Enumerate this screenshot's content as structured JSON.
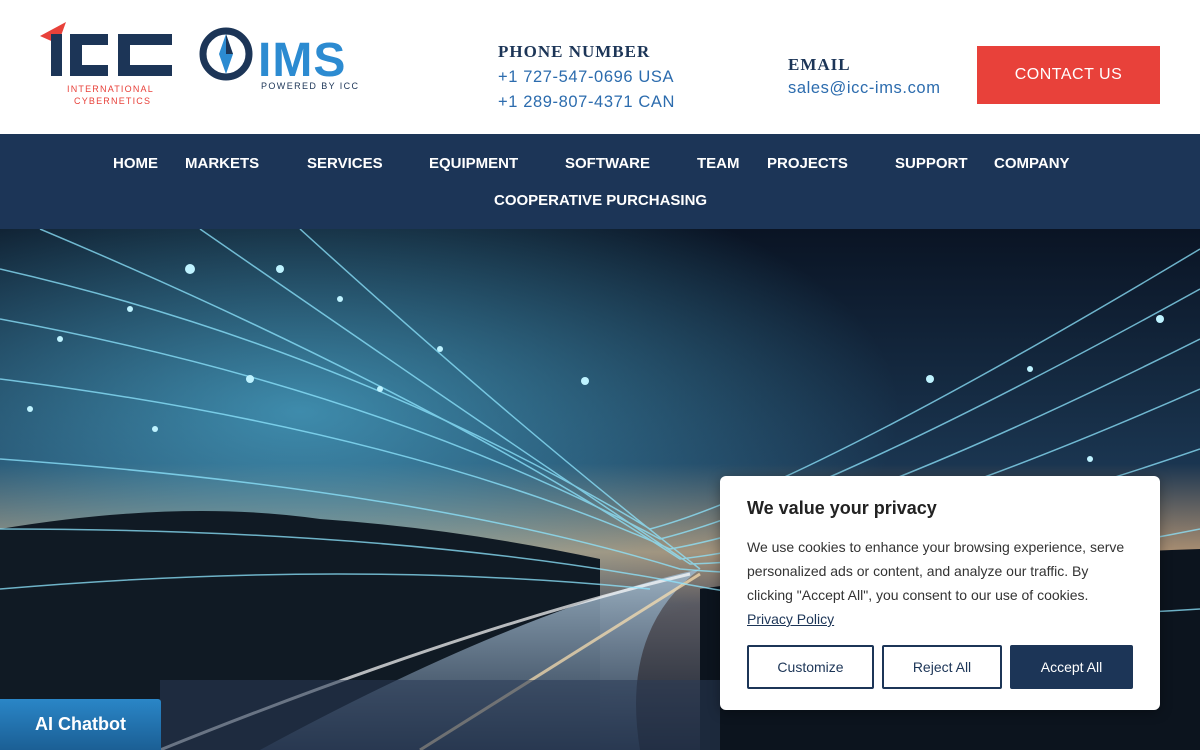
{
  "header": {
    "icc_logo": {
      "brand": "ICC",
      "tagline_1": "INTERNATIONAL",
      "tagline_2": "CYBERNETICS"
    },
    "ims_logo": {
      "brand": "IMS",
      "tagline": "POWERED BY ICC"
    },
    "phone": {
      "heading": "PHONE NUMBER",
      "line_1": "+1 727-547-0696 USA",
      "line_2": "+1 289-807-4371 CAN"
    },
    "email": {
      "heading": "EMAIL",
      "address": "sales@icc-ims.com"
    },
    "contact_button": "CONTACT US"
  },
  "nav": {
    "items": [
      "HOME",
      "MARKETS",
      "SERVICES",
      "EQUIPMENT",
      "SOFTWARE",
      "TEAM",
      "PROJECTS",
      "SUPPORT",
      "COMPANY",
      "COOPERATIVE PURCHASING"
    ]
  },
  "cookie_banner": {
    "title": "We value your privacy",
    "body": "We use cookies to enhance your browsing experience, serve personalized ads or content, and analyze our traffic. By clicking \"Accept All\", you consent to our use of cookies.",
    "policy_link": "Privacy Policy",
    "customize_label": "Customize",
    "reject_label": "Reject All",
    "accept_label": "Accept All"
  },
  "chatbot": {
    "label": "AI Chatbot"
  },
  "icons": [
    "icc-logo-icon",
    "ims-logo-icon"
  ],
  "colors": {
    "navy": "#1c3557",
    "accent_red": "#e8413a",
    "link_blue": "#2c6cae",
    "chat_blue": "#2a86c7"
  }
}
